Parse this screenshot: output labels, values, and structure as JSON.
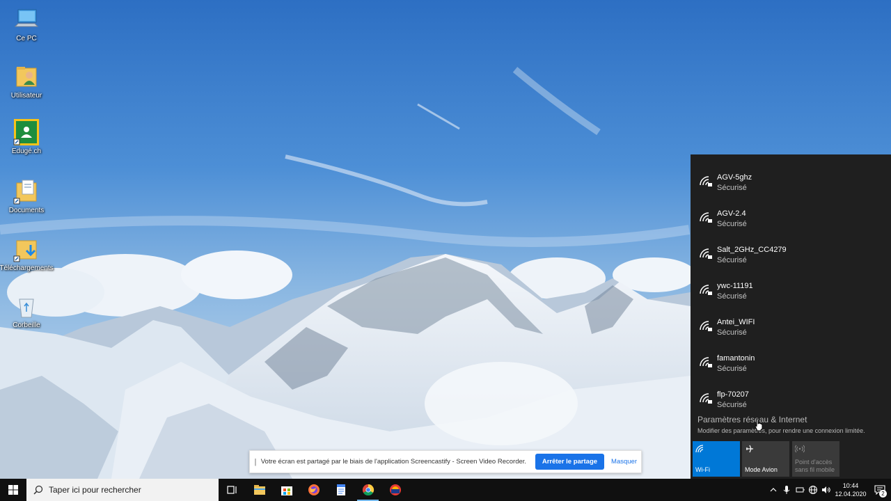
{
  "desktop": {
    "icons": [
      {
        "label": "Ce PC"
      },
      {
        "label": "Utilisateur"
      },
      {
        "label": "Edugé.ch"
      },
      {
        "label": "Documents"
      },
      {
        "label": "Téléchargements"
      },
      {
        "label": "Corbeille"
      }
    ]
  },
  "network_flyout": {
    "networks": [
      {
        "ssid": "AGV-5ghz",
        "status": "Sécurisé"
      },
      {
        "ssid": "AGV-2.4",
        "status": "Sécurisé"
      },
      {
        "ssid": "Salt_2GHz_CC4279",
        "status": "Sécurisé"
      },
      {
        "ssid": "ywc-11191",
        "status": "Sécurisé"
      },
      {
        "ssid": "Antei_WIFI",
        "status": "Sécurisé"
      },
      {
        "ssid": "famantonin",
        "status": "Sécurisé"
      },
      {
        "ssid": "flp-70207",
        "status": "Sécurisé"
      }
    ],
    "settings_title": "Paramètres réseau & Internet",
    "settings_desc": "Modifier des paramètres, pour rendre une connexion limitée.",
    "tiles": {
      "wifi": "Wi-Fi",
      "avion": "Mode Avion",
      "mobile_line1": "Point d'accès",
      "mobile_line2": "sans fil mobile"
    }
  },
  "sharebar": {
    "message": "Votre écran est partagé par le biais de l'application Screencastify - Screen Video Recorder.",
    "stop_label": "Arrêter le partage",
    "hide_label": "Masquer"
  },
  "taskbar": {
    "search_placeholder": "Taper ici pour rechercher",
    "time": "10:44",
    "date": "12.04.2020",
    "notification_count": "2"
  },
  "colors": {
    "accent": "#0078d7",
    "flyout_bg": "#1f1f1f",
    "taskbar_bg": "#101010",
    "share_button": "#1a73e8"
  }
}
